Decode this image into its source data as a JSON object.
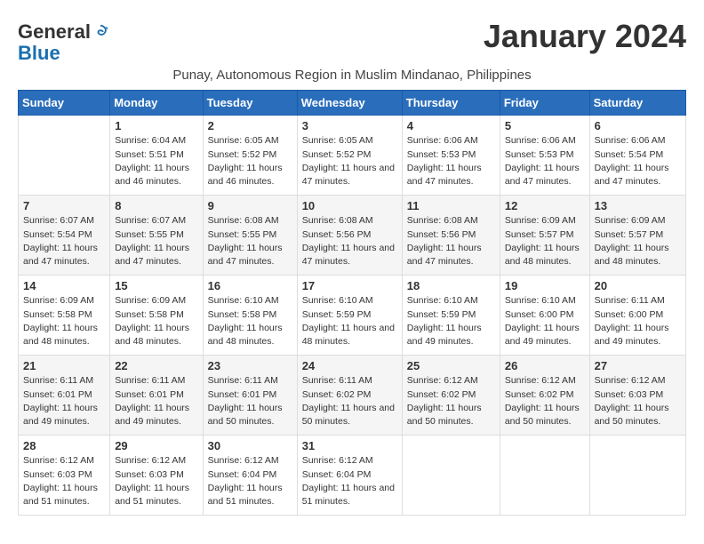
{
  "header": {
    "logo_line1": "General",
    "logo_line2": "Blue",
    "month_title": "January 2024",
    "subtitle": "Punay, Autonomous Region in Muslim Mindanao, Philippines"
  },
  "days_of_week": [
    "Sunday",
    "Monday",
    "Tuesday",
    "Wednesday",
    "Thursday",
    "Friday",
    "Saturday"
  ],
  "weeks": [
    [
      {
        "day": "",
        "sunrise": "",
        "sunset": "",
        "daylight": ""
      },
      {
        "day": "1",
        "sunrise": "Sunrise: 6:04 AM",
        "sunset": "Sunset: 5:51 PM",
        "daylight": "Daylight: 11 hours and 46 minutes."
      },
      {
        "day": "2",
        "sunrise": "Sunrise: 6:05 AM",
        "sunset": "Sunset: 5:52 PM",
        "daylight": "Daylight: 11 hours and 46 minutes."
      },
      {
        "day": "3",
        "sunrise": "Sunrise: 6:05 AM",
        "sunset": "Sunset: 5:52 PM",
        "daylight": "Daylight: 11 hours and 47 minutes."
      },
      {
        "day": "4",
        "sunrise": "Sunrise: 6:06 AM",
        "sunset": "Sunset: 5:53 PM",
        "daylight": "Daylight: 11 hours and 47 minutes."
      },
      {
        "day": "5",
        "sunrise": "Sunrise: 6:06 AM",
        "sunset": "Sunset: 5:53 PM",
        "daylight": "Daylight: 11 hours and 47 minutes."
      },
      {
        "day": "6",
        "sunrise": "Sunrise: 6:06 AM",
        "sunset": "Sunset: 5:54 PM",
        "daylight": "Daylight: 11 hours and 47 minutes."
      }
    ],
    [
      {
        "day": "7",
        "sunrise": "Sunrise: 6:07 AM",
        "sunset": "Sunset: 5:54 PM",
        "daylight": "Daylight: 11 hours and 47 minutes."
      },
      {
        "day": "8",
        "sunrise": "Sunrise: 6:07 AM",
        "sunset": "Sunset: 5:55 PM",
        "daylight": "Daylight: 11 hours and 47 minutes."
      },
      {
        "day": "9",
        "sunrise": "Sunrise: 6:08 AM",
        "sunset": "Sunset: 5:55 PM",
        "daylight": "Daylight: 11 hours and 47 minutes."
      },
      {
        "day": "10",
        "sunrise": "Sunrise: 6:08 AM",
        "sunset": "Sunset: 5:56 PM",
        "daylight": "Daylight: 11 hours and 47 minutes."
      },
      {
        "day": "11",
        "sunrise": "Sunrise: 6:08 AM",
        "sunset": "Sunset: 5:56 PM",
        "daylight": "Daylight: 11 hours and 47 minutes."
      },
      {
        "day": "12",
        "sunrise": "Sunrise: 6:09 AM",
        "sunset": "Sunset: 5:57 PM",
        "daylight": "Daylight: 11 hours and 48 minutes."
      },
      {
        "day": "13",
        "sunrise": "Sunrise: 6:09 AM",
        "sunset": "Sunset: 5:57 PM",
        "daylight": "Daylight: 11 hours and 48 minutes."
      }
    ],
    [
      {
        "day": "14",
        "sunrise": "Sunrise: 6:09 AM",
        "sunset": "Sunset: 5:58 PM",
        "daylight": "Daylight: 11 hours and 48 minutes."
      },
      {
        "day": "15",
        "sunrise": "Sunrise: 6:09 AM",
        "sunset": "Sunset: 5:58 PM",
        "daylight": "Daylight: 11 hours and 48 minutes."
      },
      {
        "day": "16",
        "sunrise": "Sunrise: 6:10 AM",
        "sunset": "Sunset: 5:58 PM",
        "daylight": "Daylight: 11 hours and 48 minutes."
      },
      {
        "day": "17",
        "sunrise": "Sunrise: 6:10 AM",
        "sunset": "Sunset: 5:59 PM",
        "daylight": "Daylight: 11 hours and 48 minutes."
      },
      {
        "day": "18",
        "sunrise": "Sunrise: 6:10 AM",
        "sunset": "Sunset: 5:59 PM",
        "daylight": "Daylight: 11 hours and 49 minutes."
      },
      {
        "day": "19",
        "sunrise": "Sunrise: 6:10 AM",
        "sunset": "Sunset: 6:00 PM",
        "daylight": "Daylight: 11 hours and 49 minutes."
      },
      {
        "day": "20",
        "sunrise": "Sunrise: 6:11 AM",
        "sunset": "Sunset: 6:00 PM",
        "daylight": "Daylight: 11 hours and 49 minutes."
      }
    ],
    [
      {
        "day": "21",
        "sunrise": "Sunrise: 6:11 AM",
        "sunset": "Sunset: 6:01 PM",
        "daylight": "Daylight: 11 hours and 49 minutes."
      },
      {
        "day": "22",
        "sunrise": "Sunrise: 6:11 AM",
        "sunset": "Sunset: 6:01 PM",
        "daylight": "Daylight: 11 hours and 49 minutes."
      },
      {
        "day": "23",
        "sunrise": "Sunrise: 6:11 AM",
        "sunset": "Sunset: 6:01 PM",
        "daylight": "Daylight: 11 hours and 50 minutes."
      },
      {
        "day": "24",
        "sunrise": "Sunrise: 6:11 AM",
        "sunset": "Sunset: 6:02 PM",
        "daylight": "Daylight: 11 hours and 50 minutes."
      },
      {
        "day": "25",
        "sunrise": "Sunrise: 6:12 AM",
        "sunset": "Sunset: 6:02 PM",
        "daylight": "Daylight: 11 hours and 50 minutes."
      },
      {
        "day": "26",
        "sunrise": "Sunrise: 6:12 AM",
        "sunset": "Sunset: 6:02 PM",
        "daylight": "Daylight: 11 hours and 50 minutes."
      },
      {
        "day": "27",
        "sunrise": "Sunrise: 6:12 AM",
        "sunset": "Sunset: 6:03 PM",
        "daylight": "Daylight: 11 hours and 50 minutes."
      }
    ],
    [
      {
        "day": "28",
        "sunrise": "Sunrise: 6:12 AM",
        "sunset": "Sunset: 6:03 PM",
        "daylight": "Daylight: 11 hours and 51 minutes."
      },
      {
        "day": "29",
        "sunrise": "Sunrise: 6:12 AM",
        "sunset": "Sunset: 6:03 PM",
        "daylight": "Daylight: 11 hours and 51 minutes."
      },
      {
        "day": "30",
        "sunrise": "Sunrise: 6:12 AM",
        "sunset": "Sunset: 6:04 PM",
        "daylight": "Daylight: 11 hours and 51 minutes."
      },
      {
        "day": "31",
        "sunrise": "Sunrise: 6:12 AM",
        "sunset": "Sunset: 6:04 PM",
        "daylight": "Daylight: 11 hours and 51 minutes."
      },
      {
        "day": "",
        "sunrise": "",
        "sunset": "",
        "daylight": ""
      },
      {
        "day": "",
        "sunrise": "",
        "sunset": "",
        "daylight": ""
      },
      {
        "day": "",
        "sunrise": "",
        "sunset": "",
        "daylight": ""
      }
    ]
  ]
}
